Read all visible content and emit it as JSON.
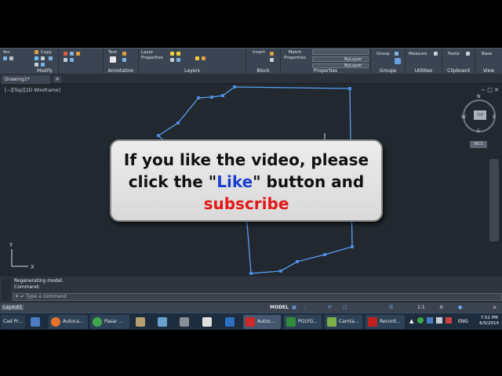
{
  "ribbon": {
    "panels": [
      {
        "title": "Modify"
      },
      {
        "title": "Annotation"
      },
      {
        "title": "Layers"
      },
      {
        "title": "Block"
      },
      {
        "title": "Properties"
      },
      {
        "title": "Groups"
      },
      {
        "title": "Utilities"
      },
      {
        "title": "Clipboard"
      },
      {
        "title": "View"
      }
    ],
    "labels": {
      "arc": "Arc",
      "copy": "Copy",
      "text": "Text",
      "layer_properties": "Layer\nProperties",
      "insert": "Insert",
      "match_properties": "Match\nProperties",
      "bylayer": "ByLayer",
      "bylayer2": "ByLayer",
      "group": "Group",
      "measure": "Measure",
      "paste": "Paste",
      "base": "Base"
    }
  },
  "tabs": {
    "drawing": "Drawing1*"
  },
  "viewport": {
    "label": "[−][Top][2D Wireframe]",
    "compass": {
      "n": "N",
      "s": "S",
      "e": "E",
      "w": "W",
      "top": "TOP"
    },
    "wcs": "WCS",
    "axis_y": "Y",
    "axis_x": "X"
  },
  "popup": {
    "line1": "If you like the video, please",
    "line2_a": "click the \"",
    "line2_like": "Like",
    "line2_b": "\" button and",
    "line3": "subscribe"
  },
  "command": {
    "history1": "Regenerating model.",
    "history2": "Command:",
    "placeholder": "Type a command"
  },
  "layout_tab": "Layout1",
  "status": {
    "model": "MODEL",
    "scale": "1:1"
  },
  "taskbar": {
    "items": [
      "Cad Pr...",
      "Autoca...",
      "Pasar ...",
      "Autoc...",
      "POLYG...",
      "Camta...",
      "Record..."
    ],
    "lang": "ENG",
    "time": "7:52 PM",
    "date": "6/5/2014"
  },
  "colors": {
    "accent": "#4aa3ff",
    "polyline": "#5aa0f0",
    "like": "#1c3fd1",
    "subscribe": "#e41818"
  }
}
